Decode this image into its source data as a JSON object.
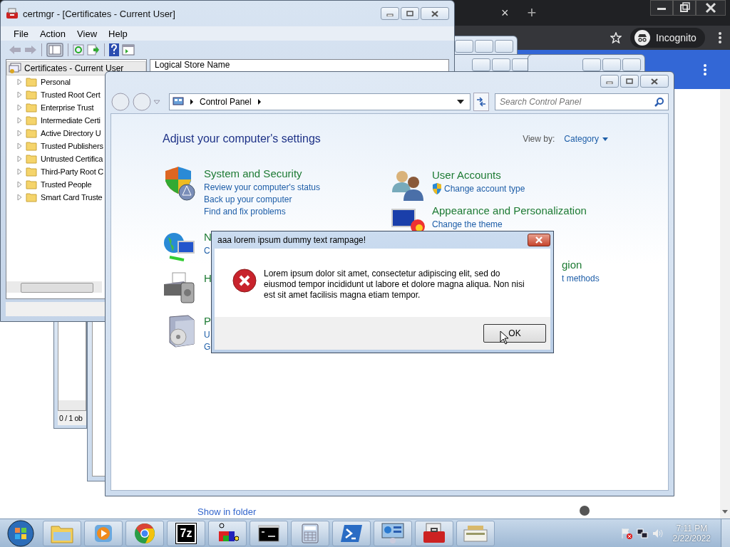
{
  "browser": {
    "tab_close": "×",
    "new_tab": "+",
    "profile_label": "Incognito",
    "page_link": "Show in folder"
  },
  "background_window": {
    "status_text": "0 / 1 ob"
  },
  "certmgr": {
    "title": "certmgr - [Certificates - Current User]",
    "menu": [
      "File",
      "Action",
      "View",
      "Help"
    ],
    "tree": {
      "label": "Certificates - Current User",
      "selected": true,
      "children": [
        {
          "label": "Personal",
          "selected": false,
          "expanded": false
        },
        {
          "label": "Trusted Root Cert",
          "selected": false,
          "expanded": false
        },
        {
          "label": "Enterprise Trust",
          "selected": false,
          "expanded": false
        },
        {
          "label": "Intermediate Certi",
          "selected": false,
          "expanded": false
        },
        {
          "label": "Active Directory U",
          "selected": false,
          "expanded": false
        },
        {
          "label": "Trusted Publishers",
          "selected": false,
          "expanded": false
        },
        {
          "label": "Untrusted Certifica",
          "selected": false,
          "expanded": false
        },
        {
          "label": "Third-Party Root C",
          "selected": false,
          "expanded": false
        },
        {
          "label": "Trusted People",
          "selected": false,
          "expanded": false
        },
        {
          "label": "Smart Card Truste",
          "selected": false,
          "expanded": false
        }
      ]
    },
    "column_header": "Logical Store Name"
  },
  "control_panel": {
    "address": "Control Panel",
    "search": {
      "placeholder": "Search Control Panel"
    },
    "heading": "Adjust your computer's settings",
    "view_by_label": "View by:",
    "view_by": "Category",
    "left_categories": [
      {
        "kind": "security",
        "title": "System and Security",
        "links": [
          {
            "text": "Review your computer's status",
            "shield": false
          },
          {
            "text": "Back up your computer",
            "shield": false
          },
          {
            "text": "Find and fix problems",
            "shield": false
          }
        ]
      },
      {
        "kind": "network",
        "title": "N",
        "links": [
          {
            "text": "C",
            "shield": false
          }
        ]
      },
      {
        "kind": "hardware",
        "title": "H"
      },
      {
        "kind": "programs",
        "title": "P",
        "links": [
          {
            "text": "U",
            "shield": false
          },
          {
            "text": "G",
            "shield": false
          }
        ]
      }
    ],
    "right_categories": [
      {
        "kind": "users",
        "title": "User Accounts",
        "links": [
          {
            "text": "Change account type",
            "shield": true
          }
        ]
      },
      {
        "kind": "appearance",
        "title": "Appearance and Personalization",
        "links": [
          {
            "text": "Change the theme",
            "shield": false
          }
        ]
      },
      {
        "kind": "covered",
        "title": "gion",
        "links": [
          {
            "text": "t methods",
            "shield": false
          }
        ]
      }
    ]
  },
  "dialog": {
    "title": "aaa lorem ipsum dummy text rampage!",
    "message": "Lorem ipsum dolor sit amet, consectetur adipiscing elit, sed do eiusmod tempor incididunt ut labore et dolore magna aliqua. Non nisi est sit amet facilisis magna etiam tempor.",
    "button": "OK"
  },
  "taskbar": {
    "apps": [
      {
        "kind": "explorer"
      },
      {
        "kind": "media"
      },
      {
        "kind": "chrome"
      },
      {
        "kind": "archiver",
        "label": "7z"
      },
      {
        "kind": "cube"
      },
      {
        "kind": "terminal"
      },
      {
        "kind": "calculator"
      },
      {
        "kind": "powershell"
      },
      {
        "kind": "control_panel"
      },
      {
        "kind": "toolbox"
      },
      {
        "kind": "scanner"
      }
    ],
    "time": "7:11 PM",
    "date": "2/22/2022"
  }
}
